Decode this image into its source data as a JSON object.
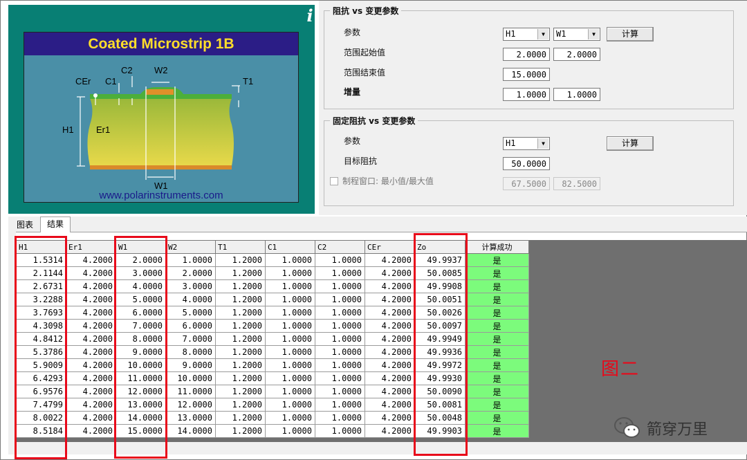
{
  "diagram": {
    "title": "Coated Microstrip 1B",
    "url": "www.polarinstruments.com",
    "labels": {
      "c2": "C2",
      "w2": "W2",
      "cer": "CEr",
      "c1": "C1",
      "t1": "T1",
      "h1": "H1",
      "er1": "Er1",
      "w1": "W1"
    },
    "info_icon": "info-icon"
  },
  "impedance_vs_param": {
    "title": "阻抗 vs 变更参数",
    "param_label": "参数",
    "param1": "H1",
    "param2": "W1",
    "calc_label": "计算",
    "start_label": "范围起始值",
    "start1": "2.0000",
    "start2": "2.0000",
    "end_label": "范围结束值",
    "end1": "15.0000",
    "step_label": "增量",
    "step1": "1.0000",
    "step2": "1.0000"
  },
  "fixed_impedance": {
    "title": "固定阻抗 vs 变更参数",
    "param_label": "参数",
    "param": "H1",
    "calc_label": "计算",
    "target_label": "目标阻抗",
    "target": "50.0000",
    "window_label": "制程窗口: 最小值/最大值",
    "window_min": "67.5000",
    "window_max": "82.5000"
  },
  "tabs": [
    "图表",
    "结果"
  ],
  "results": {
    "columns": [
      "H1",
      "Er1",
      "W1",
      "W2",
      "T1",
      "C1",
      "C2",
      "CEr",
      "Zo",
      "计算成功"
    ],
    "rows": [
      [
        "1.5314",
        "4.2000",
        "2.0000",
        "1.0000",
        "1.2000",
        "1.0000",
        "1.0000",
        "4.2000",
        "49.9937",
        "是"
      ],
      [
        "2.1144",
        "4.2000",
        "3.0000",
        "2.0000",
        "1.2000",
        "1.0000",
        "1.0000",
        "4.2000",
        "50.0085",
        "是"
      ],
      [
        "2.6731",
        "4.2000",
        "4.0000",
        "3.0000",
        "1.2000",
        "1.0000",
        "1.0000",
        "4.2000",
        "49.9908",
        "是"
      ],
      [
        "3.2288",
        "4.2000",
        "5.0000",
        "4.0000",
        "1.2000",
        "1.0000",
        "1.0000",
        "4.2000",
        "50.0051",
        "是"
      ],
      [
        "3.7693",
        "4.2000",
        "6.0000",
        "5.0000",
        "1.2000",
        "1.0000",
        "1.0000",
        "4.2000",
        "50.0026",
        "是"
      ],
      [
        "4.3098",
        "4.2000",
        "7.0000",
        "6.0000",
        "1.2000",
        "1.0000",
        "1.0000",
        "4.2000",
        "50.0097",
        "是"
      ],
      [
        "4.8412",
        "4.2000",
        "8.0000",
        "7.0000",
        "1.2000",
        "1.0000",
        "1.0000",
        "4.2000",
        "49.9949",
        "是"
      ],
      [
        "5.3786",
        "4.2000",
        "9.0000",
        "8.0000",
        "1.2000",
        "1.0000",
        "1.0000",
        "4.2000",
        "49.9936",
        "是"
      ],
      [
        "5.9009",
        "4.2000",
        "10.0000",
        "9.0000",
        "1.2000",
        "1.0000",
        "1.0000",
        "4.2000",
        "49.9972",
        "是"
      ],
      [
        "6.4293",
        "4.2000",
        "11.0000",
        "10.0000",
        "1.2000",
        "1.0000",
        "1.0000",
        "4.2000",
        "49.9930",
        "是"
      ],
      [
        "6.9576",
        "4.2000",
        "12.0000",
        "11.0000",
        "1.2000",
        "1.0000",
        "1.0000",
        "4.2000",
        "50.0090",
        "是"
      ],
      [
        "7.4799",
        "4.2000",
        "13.0000",
        "12.0000",
        "1.2000",
        "1.0000",
        "1.0000",
        "4.2000",
        "50.0081",
        "是"
      ],
      [
        "8.0022",
        "4.2000",
        "14.0000",
        "13.0000",
        "1.2000",
        "1.0000",
        "1.0000",
        "4.2000",
        "50.0048",
        "是"
      ],
      [
        "8.5184",
        "4.2000",
        "15.0000",
        "14.0000",
        "1.2000",
        "1.0000",
        "1.0000",
        "4.2000",
        "49.9903",
        "是"
      ]
    ]
  },
  "annotation": {
    "figure_label": "图二",
    "highlight_color": "#e8091a"
  },
  "watermark": {
    "text": "箭穿万里",
    "icon": "wechat-icon"
  },
  "colors": {
    "success_cell": "#7cfb7c",
    "diagram_bg": "#087f74",
    "title_bar": "#2b1d86",
    "title_text": "#ffde2a"
  }
}
